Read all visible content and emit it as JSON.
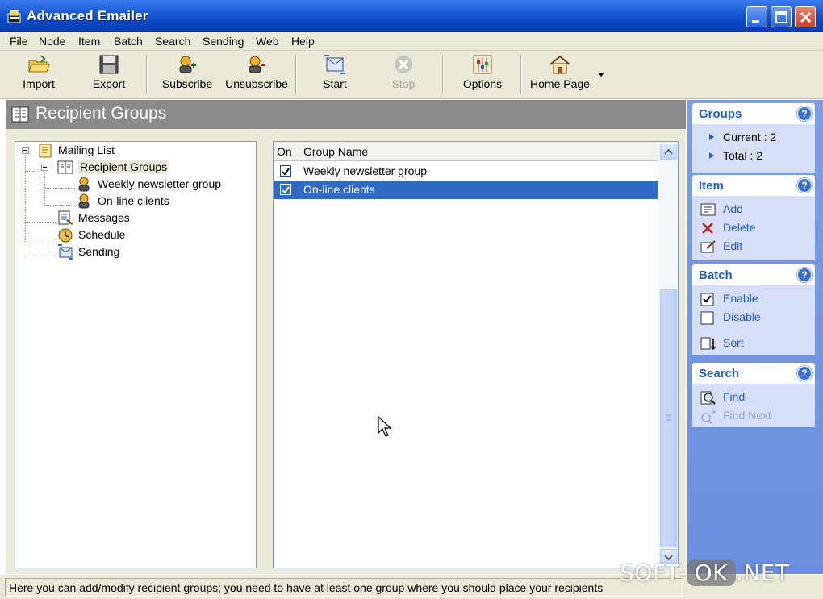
{
  "window": {
    "title": "Advanced Emailer"
  },
  "menu": [
    "File",
    "Node",
    "Item",
    "Batch",
    "Search",
    "Sending",
    "Web",
    "Help"
  ],
  "toolbar": {
    "import": "Import",
    "export": "Export",
    "subscribe": "Subscribe",
    "unsubscribe": "Unsubscribe",
    "start": "Start",
    "stop": "Stop",
    "options": "Options",
    "home_page": "Home Page"
  },
  "header": {
    "title": "Recipient Groups"
  },
  "tree": {
    "root": "Mailing List",
    "recipient_groups": "Recipient Groups",
    "group1": "Weekly newsletter group",
    "group2": "On-line clients",
    "messages": "Messages",
    "schedule": "Schedule",
    "sending": "Sending"
  },
  "list": {
    "columns": [
      "On",
      "Group Name"
    ],
    "rows": [
      {
        "on": true,
        "name": "Weekly newsletter group",
        "selected": false
      },
      {
        "on": true,
        "name": "On-line clients",
        "selected": true
      }
    ]
  },
  "taskpane": {
    "groups": {
      "title": "Groups",
      "current": "Current : 2",
      "total": "Total : 2"
    },
    "item": {
      "title": "Item",
      "add": "Add",
      "delete": "Delete",
      "edit": "Edit"
    },
    "batch": {
      "title": "Batch",
      "enable": "Enable",
      "disable": "Disable",
      "sort": "Sort"
    },
    "search": {
      "title": "Search",
      "find": "Find",
      "find_next": "Find Next"
    },
    "help_glyph": "?"
  },
  "status": {
    "text": "Here you can add/modify recipient groups; you need to have at least one group where you should place your recipients"
  },
  "watermark": {
    "left": "SOFT-",
    "ok": "OK",
    "right": ".NET"
  },
  "colors": {
    "titlebar": "#0a46c4",
    "selection": "#316ac5",
    "taskpane": "#7b9de6",
    "taskpane_link": "#215dc6",
    "header": "#8a8a8a"
  }
}
